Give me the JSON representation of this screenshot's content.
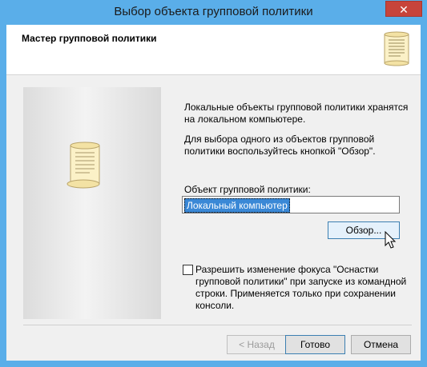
{
  "window": {
    "title": "Выбор объекта групповой политики",
    "close_glyph": "✕"
  },
  "header": {
    "title": "Мастер групповой политики",
    "icon": "scroll-icon"
  },
  "body": {
    "intro": "Локальные объекты групповой политики хранятся на локальном компьютере.",
    "instruction": "Для выбора одного из объектов групповой политики воспользуйтесь кнопкой \"Обзор\".",
    "gpo_label": "Объект групповой политики:",
    "gpo_value": "Локальный компьютер",
    "browse_label": "Обзор...",
    "allow_focus_change": {
      "checked": false,
      "label": "Разрешить изменение фокуса \"Оснастки групповой политики\" при запуске из командной строки. Применяется только при сохранении консоли."
    }
  },
  "buttons": {
    "back": "< Назад",
    "finish": "Готово",
    "cancel": "Отмена"
  },
  "colors": {
    "titlebar": "#5aaee9",
    "close": "#c7443b",
    "selection": "#3a88d6"
  }
}
